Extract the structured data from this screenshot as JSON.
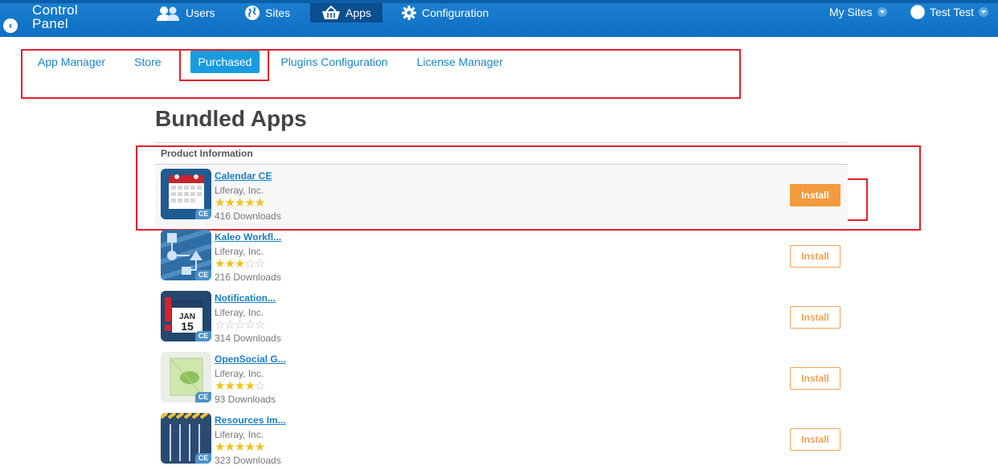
{
  "header": {
    "control_panel_line1": "Control",
    "control_panel_line2": "Panel",
    "nav": [
      {
        "label": "Users"
      },
      {
        "label": "Sites"
      },
      {
        "label": "Apps"
      },
      {
        "label": "Configuration"
      }
    ],
    "my_sites": "My Sites",
    "user_name": "Test Test"
  },
  "subtabs": [
    {
      "label": "App Manager"
    },
    {
      "label": "Store"
    },
    {
      "label": "Purchased"
    },
    {
      "label": "Plugins Configuration"
    },
    {
      "label": "License Manager"
    }
  ],
  "page_title": "Bundled Apps",
  "table_header": "Product Information",
  "apps": [
    {
      "name": "Calendar CE",
      "vendor": "Liferay, Inc.",
      "rating": 5,
      "downloads": "416 Downloads",
      "install_label": "Install",
      "badge": "CE"
    },
    {
      "name": "Kaleo Workfl...",
      "vendor": "Liferay, Inc.",
      "rating": 3,
      "downloads": "216 Downloads",
      "install_label": "Install",
      "badge": "CE"
    },
    {
      "name": "Notification...",
      "vendor": "Liferay, Inc.",
      "rating": 0,
      "downloads": "314 Downloads",
      "install_label": "Install",
      "badge": "CE",
      "icon_text_top": "JAN",
      "icon_text_day": "15"
    },
    {
      "name": "OpenSocial G...",
      "vendor": "Liferay, Inc.",
      "rating": 4,
      "downloads": "93 Downloads",
      "install_label": "Install",
      "badge": "CE"
    },
    {
      "name": "Resources Im...",
      "vendor": "Liferay, Inc.",
      "rating": 5,
      "downloads": "323 Downloads",
      "install_label": "Install",
      "badge": "CE"
    }
  ],
  "colors": {
    "topbar": "#1a7fd0",
    "link": "#1a84c8",
    "install": "#f39a3d",
    "highlight_box": "#e3202c"
  }
}
